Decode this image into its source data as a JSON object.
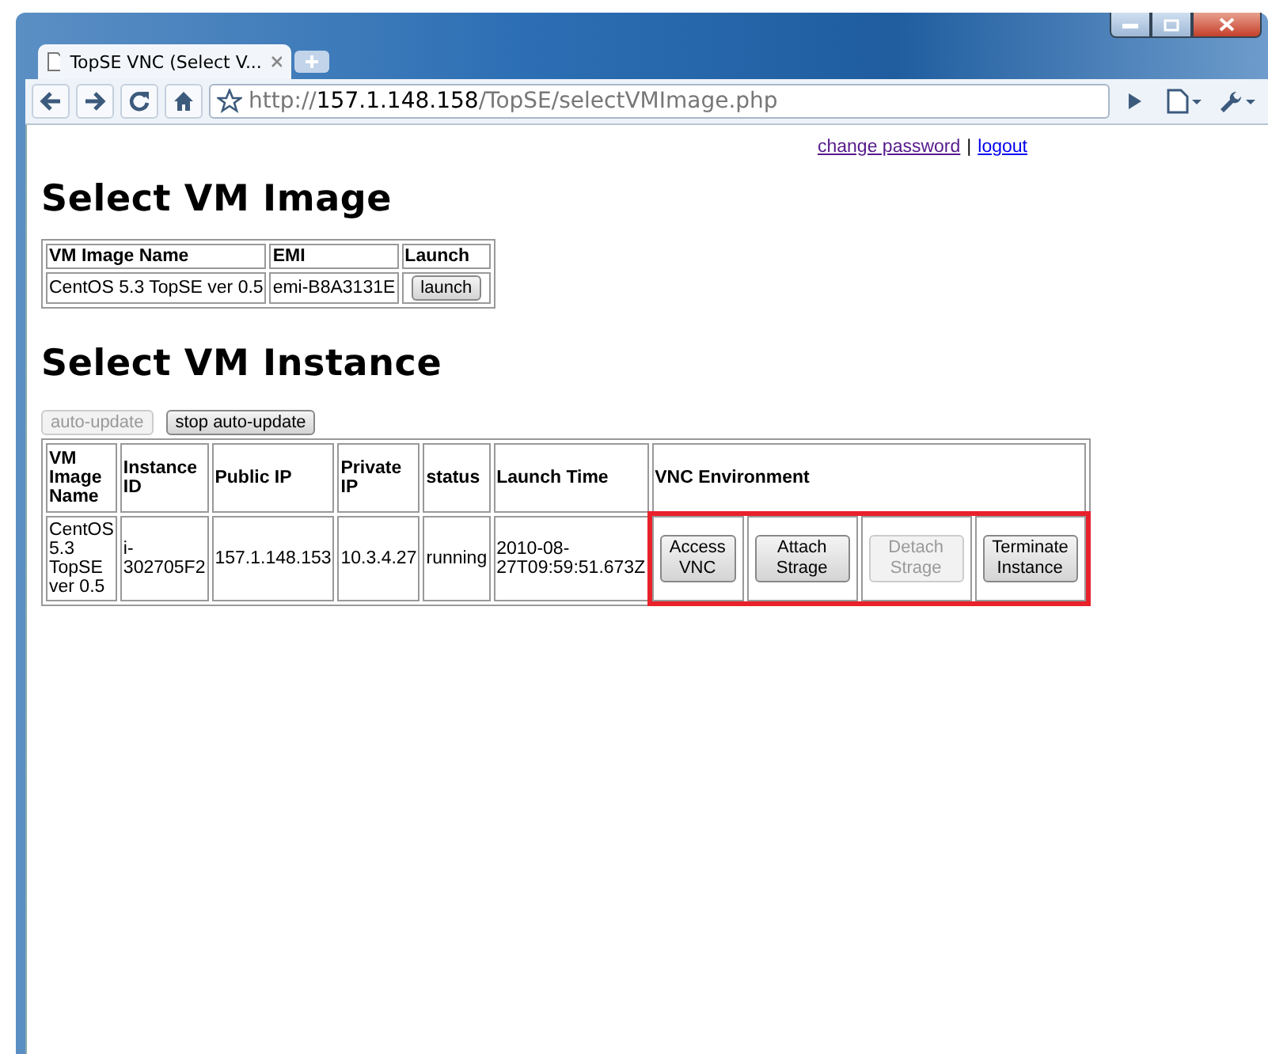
{
  "browser": {
    "tab_title": "TopSE VNC (Select V...",
    "url": {
      "scheme": "http://",
      "host": "157.1.148.158",
      "path": "/TopSE/selectVMImage.php"
    }
  },
  "top_links": [
    {
      "label": "change password",
      "visited": true
    },
    {
      "label": "logout",
      "visited": false
    }
  ],
  "link_separator": "|",
  "image_section": {
    "heading": "Select VM Image",
    "table": {
      "columns": [
        "VM Image Name",
        "EMI",
        "Launch"
      ],
      "rows": [
        {
          "name": "CentOS 5.3 TopSE ver 0.5",
          "emi": "emi-B8A3131E",
          "button": "launch"
        }
      ]
    }
  },
  "instance_section": {
    "heading": "Select VM Instance",
    "update_buttons": [
      {
        "label": "auto-update",
        "disabled": true
      },
      {
        "label": "stop auto-update",
        "disabled": false
      }
    ],
    "table": {
      "columns": [
        "VM Image Name",
        "Instance ID",
        "Public IP",
        "Private IP",
        "status",
        "Launch Time",
        "VNC Environment"
      ],
      "rows": [
        {
          "cells": [
            "CentOS 5.3 TopSE ver 0.5",
            "i-302705F2",
            "157.1.148.153",
            "10.3.4.27",
            "running",
            "2010-08-27T09:59:51.673Z"
          ],
          "highlighted": true,
          "actions": [
            {
              "label": "Access VNC",
              "disabled": false
            },
            {
              "label": "Attach Strage",
              "disabled": false
            },
            {
              "label": "Detach Strage",
              "disabled": true
            },
            {
              "label": "Terminate Instance",
              "disabled": false
            }
          ]
        }
      ]
    }
  }
}
